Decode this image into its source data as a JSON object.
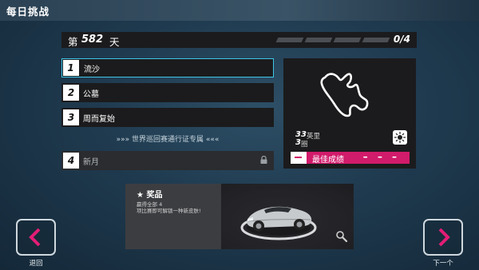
{
  "header": {
    "title": "每日挑战"
  },
  "day": {
    "prefix": "第",
    "number": "582",
    "suffix": "天",
    "progress_done": 0,
    "progress_total": 4,
    "progress_text": "0/4"
  },
  "stages": [
    {
      "num": "1",
      "name": "流沙",
      "selected": true,
      "locked": false
    },
    {
      "num": "2",
      "name": "公墓",
      "selected": false,
      "locked": false
    },
    {
      "num": "3",
      "name": "周而复始",
      "selected": false,
      "locked": false
    },
    {
      "num": "4",
      "name": "新月",
      "selected": false,
      "locked": true
    }
  ],
  "pass_label": "»»» 世界巡回赛通行证专属 «««",
  "track": {
    "distance": "33",
    "distance_unit": "英里",
    "laps": "3",
    "laps_unit": "圈",
    "weather_icon": "sun-icon",
    "best_label": "最佳成绩",
    "best_time": "– – –"
  },
  "reward": {
    "title": "★ 奖品",
    "line1": "赢得全部 4",
    "line2": "项比赛即可解锁一种新皮肤!"
  },
  "nav": {
    "back_label": "退回",
    "next_label": "下一个"
  },
  "colors": {
    "accent_cyan": "#3fc6e6",
    "accent_pink": "#d11b6b",
    "panel": "#1b1b1d"
  }
}
